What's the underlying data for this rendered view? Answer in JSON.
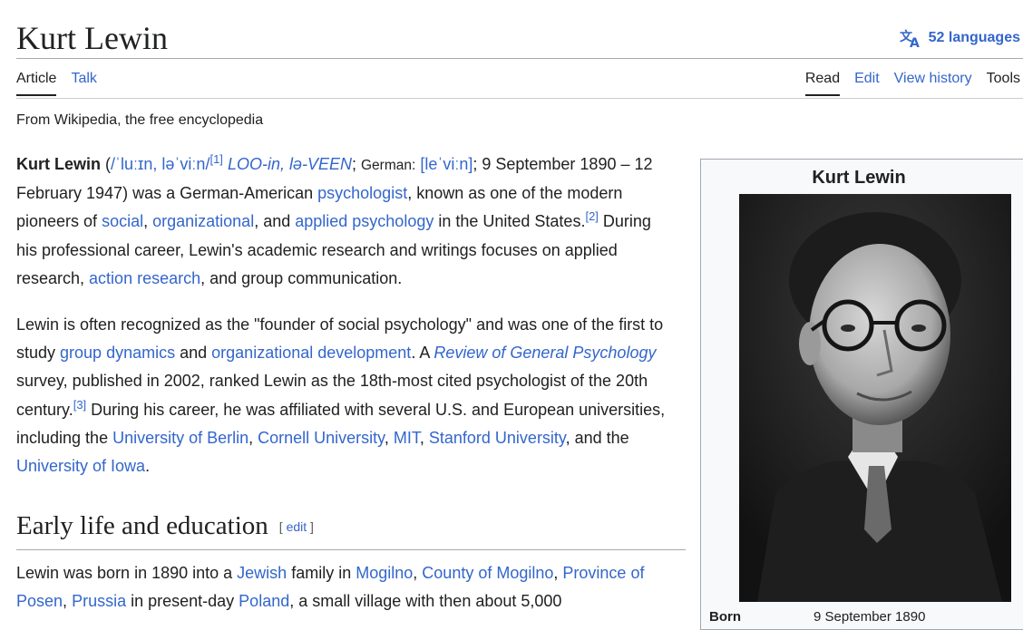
{
  "header": {
    "title": "Kurt Lewin",
    "languages_label": "52 languages"
  },
  "tabs": {
    "left": [
      "Article",
      "Talk"
    ],
    "right": [
      "Read",
      "Edit",
      "View history",
      "Tools"
    ]
  },
  "tagline": "From Wikipedia, the free encyclopedia",
  "intro": {
    "name": "Kurt Lewin",
    "ipa": "/ˈluːɪn, ləˈviːn/",
    "ref1": "[1]",
    "respell": "LOO-in, lə-VEEN",
    "german_label": "German:",
    "german_ipa": "[leˈviːn]",
    "dates_text": "; 9 September 1890 – 12 February 1947) was a German-American ",
    "psychologist": "psychologist",
    "t1": ", known as one of the modern pioneers of ",
    "social": "social",
    "organizational": "organizational",
    "t2": ", and ",
    "applied": "applied psychology",
    "t3": " in the United States.",
    "ref2": "[2]",
    "t4": " During his professional career, Lewin's academic research and writings focuses on applied research, ",
    "action": "action research",
    "t5": ", and group communication."
  },
  "para2": {
    "t1": "Lewin is often recognized as the \"founder of social psychology\" and was one of the first to study ",
    "group_dynamics": "group dynamics",
    "t2": " and ",
    "org_dev": "organizational development",
    "t3": ". A ",
    "review": "Review of General Psychology",
    "t4": " survey, published in 2002, ranked Lewin as the 18th-most cited psychologist of the 20th century.",
    "ref3": "[3]",
    "t5": " During his career, he was affiliated with several U.S. and European universities, including the ",
    "berlin": "University of Berlin",
    "cornell": "Cornell University",
    "mit": "MIT",
    "stanford": "Stanford University",
    "t6": ", and the ",
    "iowa": "University of Iowa",
    "t7": "."
  },
  "section": {
    "heading": "Early life and education",
    "edit_open": "[ ",
    "edit_label": "edit",
    "edit_close": " ]"
  },
  "para3": {
    "t1": "Lewin was born in 1890 into a ",
    "jewish": "Jewish",
    "t2": " family in ",
    "mogilno": "Mogilno",
    "county": "County of Mogilno",
    "province": "Province of Posen",
    "prussia": "Prussia",
    "t3": " in present-day ",
    "poland": "Poland",
    "t4": ", a small village with then about 5,000"
  },
  "infobox": {
    "title": "Kurt Lewin",
    "born_label": "Born",
    "born_value": "9 September 1890"
  },
  "colors": {
    "link": "#3366cc",
    "text": "#202122",
    "rule": "#a2a9b1",
    "infobox_bg": "#f8f9fa"
  }
}
